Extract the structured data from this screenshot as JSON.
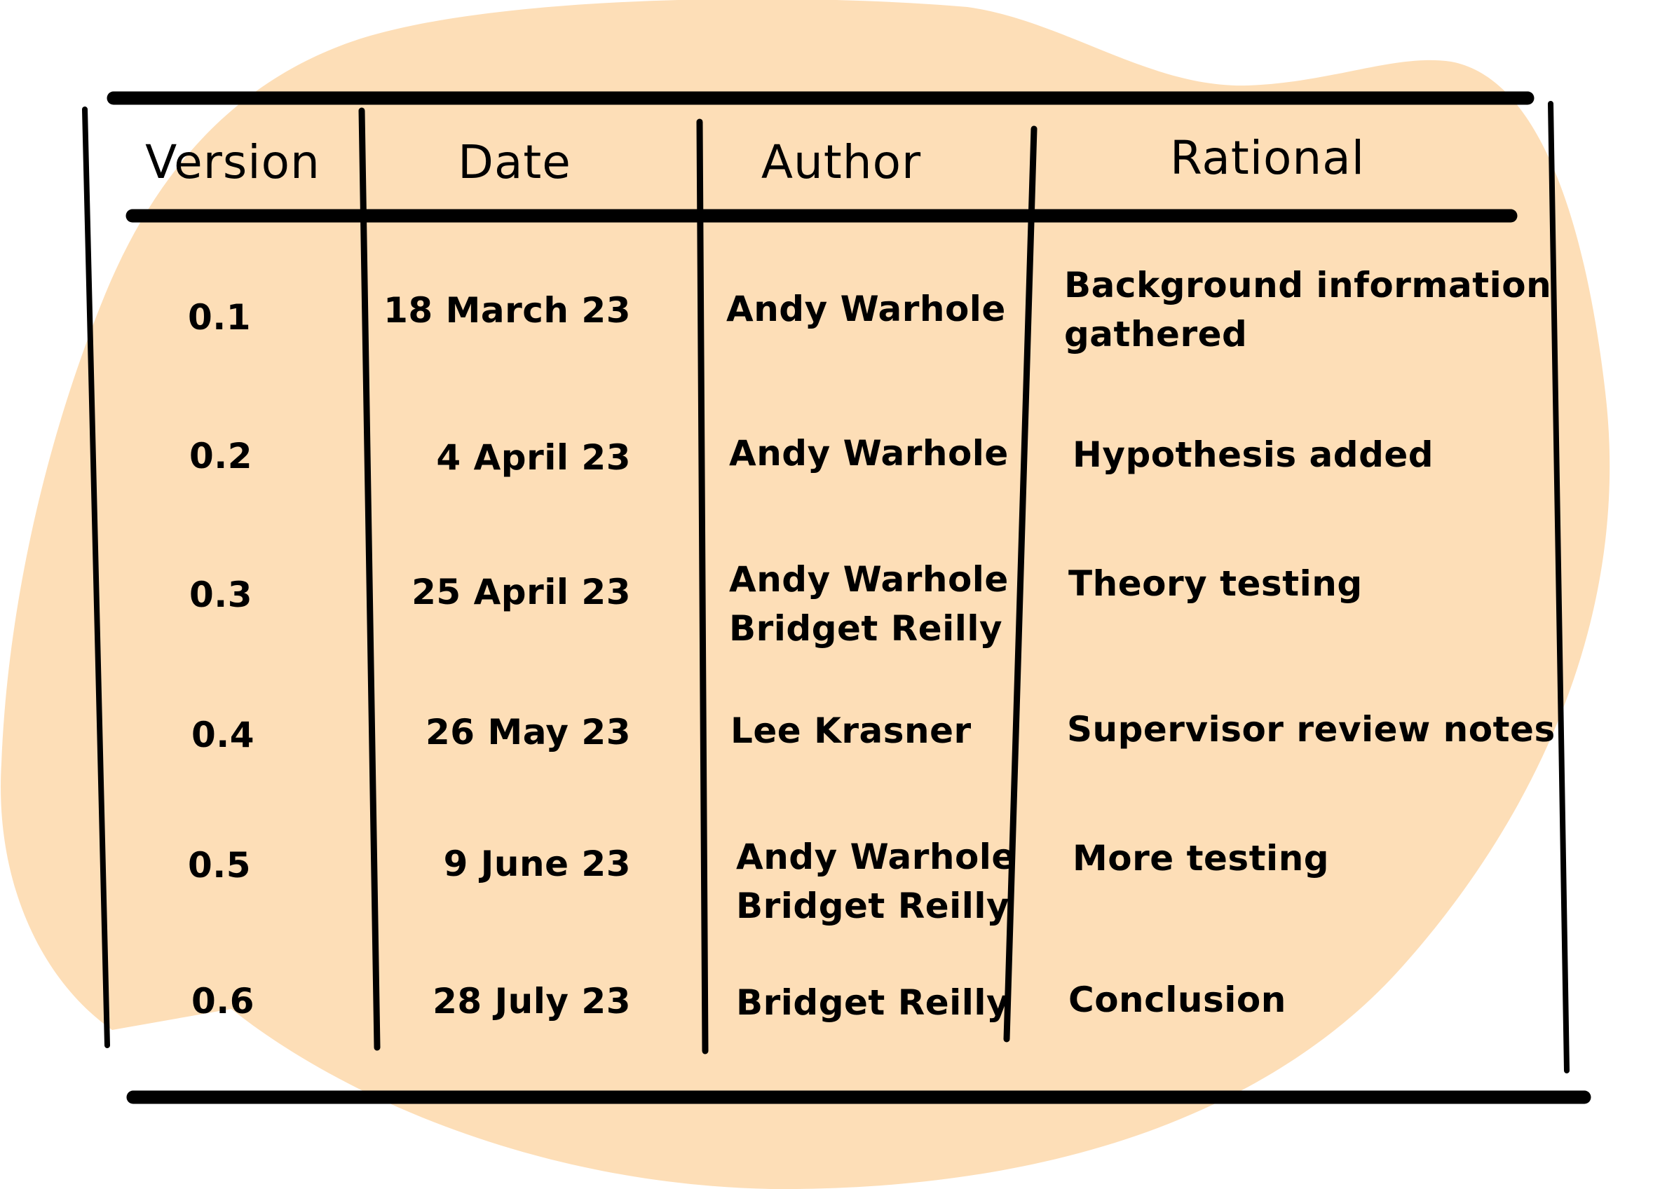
{
  "colors": {
    "blob": "#FDDEB7",
    "ink": "#000000",
    "background": "#FFFFFF"
  },
  "table": {
    "headers": [
      "Version",
      "Date",
      "Author",
      "Rational"
    ],
    "rows": [
      {
        "version": "0.1",
        "date": "18 March 23",
        "author": "Andy Warhole",
        "rationale": "Background information\ngathered"
      },
      {
        "version": "0.2",
        "date": "4 April 23",
        "author": "Andy Warhole",
        "rationale": "Hypothesis added"
      },
      {
        "version": "0.3",
        "date": "25 April 23",
        "author": "Andy Warhole\nBridget Reilly",
        "rationale": "Theory testing"
      },
      {
        "version": "0.4",
        "date": "26 May 23",
        "author": "Lee Krasner",
        "rationale": "Supervisor review notes"
      },
      {
        "version": "0.5",
        "date": "9 June 23",
        "author": "Andy Warhole\nBridget Reilly",
        "rationale": "More testing"
      },
      {
        "version": "0.6",
        "date": "28 July 23",
        "author": "Bridget Reilly",
        "rationale": "Conclusion"
      }
    ]
  }
}
